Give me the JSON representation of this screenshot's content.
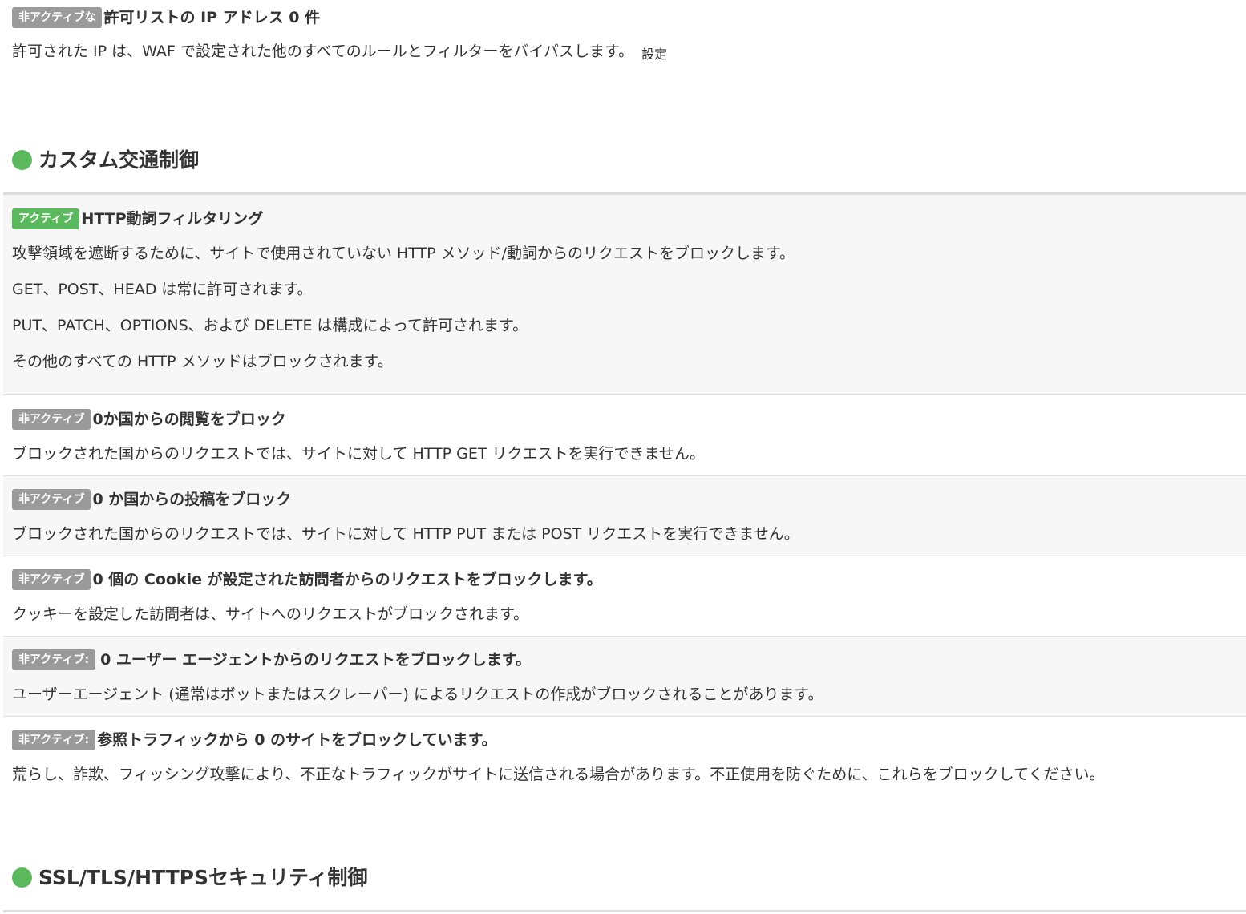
{
  "allowlist": {
    "badge": "非アクティブな",
    "title": "許可リストの IP アドレス 0 件",
    "description": "許可された IP は、WAF で設定された他のすべてのルールとフィルターをバイパスします。",
    "settings_link": "設定"
  },
  "custom_traffic": {
    "title": "カスタム交通制御",
    "rules": [
      {
        "badge": "アクティブ",
        "title": "HTTP動詞フィルタリング",
        "descriptions": [
          "攻撃領域を遮断するために、サイトで使用されていない HTTP メソッド/動詞からのリクエストをブロックします。",
          "GET、POST、HEAD は常に許可されます。",
          "PUT、PATCH、OPTIONS、および DELETE は構成によって許可されます。",
          "その他のすべての HTTP メソッドはブロックされます。"
        ]
      },
      {
        "badge": "非アクティブ",
        "title": "0か国からの閲覧をブロック",
        "descriptions": [
          "ブロックされた国からのリクエストでは、サイトに対して HTTP GET リクエストを実行できません。"
        ]
      },
      {
        "badge": "非アクティブ",
        "title": "0 か国からの投稿をブロック",
        "descriptions": [
          "ブロックされた国からのリクエストでは、サイトに対して HTTP PUT または POST リクエストを実行できません。"
        ]
      },
      {
        "badge": "非アクティブ",
        "title": "0 個の Cookie が設定された訪問者からのリクエストをブロックします。",
        "descriptions": [
          "クッキーを設定した訪問者は、サイトへのリクエストがブロックされます。"
        ]
      },
      {
        "badge": "非アクティブ:",
        "title": "0 ユーザー エージェントからのリクエストをブロックします。",
        "descriptions": [
          "ユーザーエージェント (通常はボットまたはスクレーパー) によるリクエストの作成がブロックされることがあります。"
        ]
      },
      {
        "badge": "非アクティブ:",
        "title": "参照トラフィックから 0 のサイトをブロックしています。",
        "descriptions": [
          "荒らし、詐欺、フィッシング攻撃により、不正なトラフィックがサイトに送信される場合があります。不正使用を防ぐために、これらをブロックしてください。"
        ]
      }
    ]
  },
  "ssl_section": {
    "title": "SSL/TLS/HTTPSセキュリティ制御"
  },
  "colors": {
    "active": "#5cb85c",
    "inactive": "#9a9a9a",
    "status_dot": "#5cb85c",
    "shaded_row": "#f7f7f7",
    "text": "#333333"
  }
}
